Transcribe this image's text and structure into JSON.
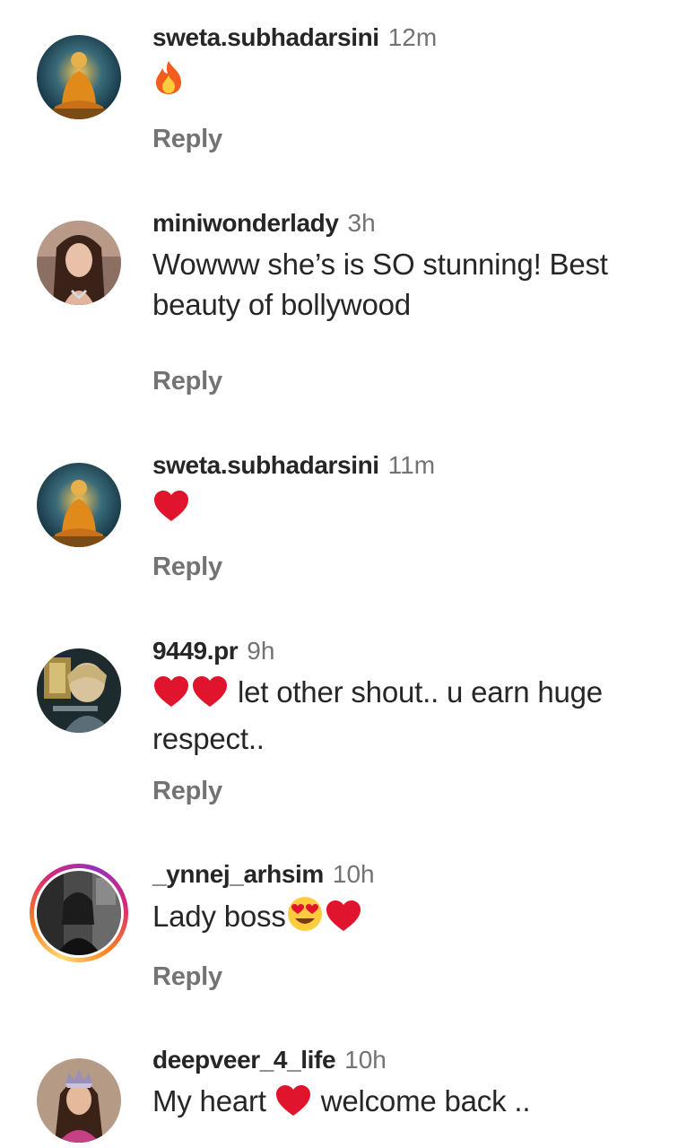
{
  "comments": [
    {
      "username": "sweta.subhadarsini",
      "time": "12m",
      "text_after": "",
      "reply_label": "Reply",
      "emojis": [
        "fire-emoji"
      ]
    },
    {
      "username": "miniwonderlady",
      "time": "3h",
      "text_line1": "Wowww she’s is SO stunning! Best",
      "text_line2": "beauty of bollywood",
      "reply_label": "Reply"
    },
    {
      "username": "sweta.subhadarsini",
      "time": "11m",
      "reply_label": "Reply",
      "emojis": [
        "red-heart-emoji"
      ]
    },
    {
      "username": "9449.pr",
      "time": "9h",
      "text_line1": " let other shout.. u earn huge",
      "text_line2": "respect..",
      "reply_label": "Reply",
      "emojis": [
        "red-heart-emoji",
        "red-heart-emoji"
      ]
    },
    {
      "username": "_ynnej_arhsim",
      "time": "10h",
      "text_before": "Lady boss",
      "reply_label": "Reply",
      "emojis": [
        "heart-eyes-emoji",
        "red-heart-emoji"
      ],
      "has_story": true
    },
    {
      "username": "deepveer_4_life",
      "time": "10h",
      "text_before": "My heart ",
      "text_after": " welcome back ..",
      "emojis": [
        "red-heart-emoji"
      ]
    }
  ],
  "colors": {
    "username": "#262626",
    "secondary": "#737373",
    "heart": "#e0142d"
  }
}
